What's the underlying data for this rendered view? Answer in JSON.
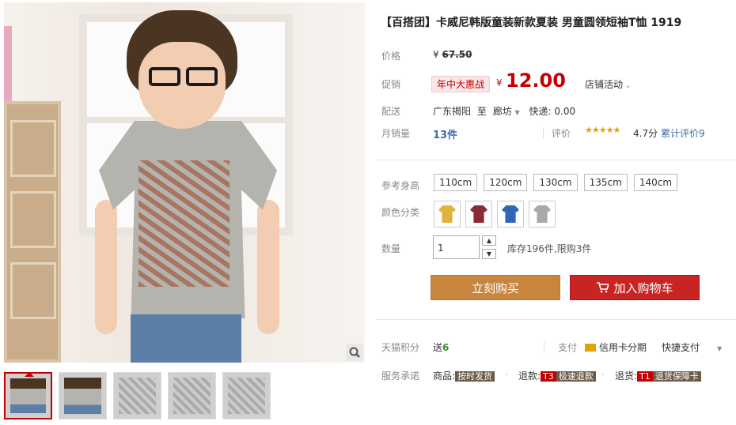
{
  "product": {
    "title": "【百搭团】卡威尼韩版童装新款夏装 男童圆领短袖T恤 1919"
  },
  "labels": {
    "price": "价格",
    "promo": "促销",
    "shipping": "配送",
    "monthly_sales": "月销量",
    "ref_height": "参考身高",
    "color": "颜色分类",
    "quantity": "数量",
    "points": "天猫积分",
    "service": "服务承诺"
  },
  "price": {
    "original_yen": "¥",
    "original": "67.50",
    "promo_tag": "年中大惠战",
    "current_yen": "¥",
    "current": "12.00",
    "shop_activity": "店铺活动"
  },
  "shipping": {
    "from": "广东揭阳",
    "to_word": "至",
    "to": "廊坊",
    "fee": "快递: 0.00"
  },
  "sales": {
    "count": "13件",
    "review_label": "评价",
    "stars": "★★★★★",
    "score": "4.7分",
    "cumulative": "累计评价9"
  },
  "sizes": [
    "110cm",
    "120cm",
    "130cm",
    "135cm",
    "140cm"
  ],
  "colors": [
    {
      "name": "yellow",
      "hex": "#e0b43a"
    },
    {
      "name": "burgundy",
      "hex": "#8a2a36"
    },
    {
      "name": "blue",
      "hex": "#2e66b8"
    },
    {
      "name": "gray",
      "hex": "#a9a9a9"
    }
  ],
  "quantity": {
    "value": "1",
    "stock": "库存196件,限购3件"
  },
  "buttons": {
    "buy_now": "立刻购买",
    "add_to_cart": "加入购物车"
  },
  "points": {
    "give": "送",
    "amount": "6",
    "pay_label": "支付",
    "card": "信用卡分期",
    "fast_pay": "快捷支付"
  },
  "service": {
    "goods_label": "商品:",
    "goods_badge": "按时发货",
    "refund_label": "退款:",
    "refund_t": "T3",
    "refund_badge": "极速退款",
    "return_label": "退货:",
    "return_t": "T1",
    "return_badge": "退货保障卡"
  }
}
